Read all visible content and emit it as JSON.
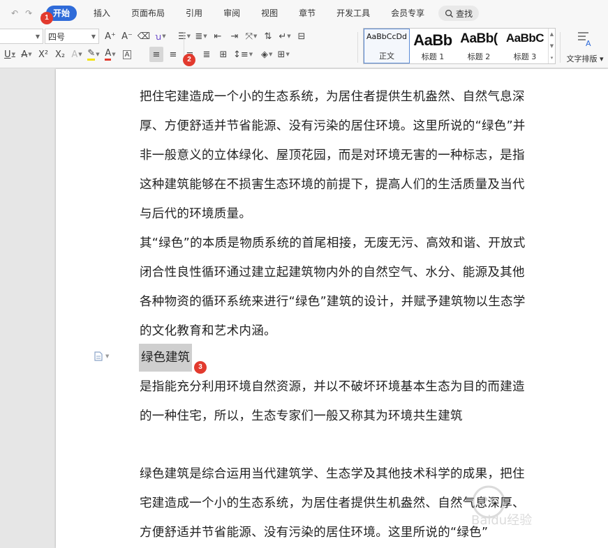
{
  "menu": {
    "tabs": [
      "开始",
      "插入",
      "页面布局",
      "引用",
      "审阅",
      "视图",
      "章节",
      "开发工具",
      "会员专享"
    ],
    "active_index": 0,
    "search_label": "查找"
  },
  "ribbon": {
    "font_size": "四号",
    "font_name": "",
    "styles": [
      {
        "sample": "AaBbCcDd",
        "caption": "正文"
      },
      {
        "sample": "AaBb",
        "caption": "标题 1"
      },
      {
        "sample": "AaBb(",
        "caption": "标题 2"
      },
      {
        "sample": "AaBbC",
        "caption": "标题 3"
      }
    ],
    "text_layout_label": "文字排版"
  },
  "badges": [
    "1",
    "2",
    "3"
  ],
  "document": {
    "para1": "把住宅建造成一个小的生态系统，为居住者提供生机盎然、自然气息深厚、方便舒适并节省能源、没有污染的居住环境。这里所说的“绿色”并非一般意义的立体绿化、屋顶花园，而是对环境无害的一种标志，是指这种建筑能够在不损害生态环境的前提下，提高人们的生活质量及当代与后代的环境质量。",
    "para2": "其“绿色”的本质是物质系统的首尾相接，无废无污、高效和谐、开放式闭合性良性循环通过建立起建筑物内外的自然空气、水分、能源及其他各种物资的循环系统来进行“绿色”建筑的设计，并赋予建筑物以生态学的文化教育和艺术内涵。",
    "heading": "绿色建筑",
    "para3": "是指能充分利用环境自然资源，并以不破坏环境基本生态为目的而建造的一种住宅，所以，生态专家们一般又称其为环境共生建筑",
    "para4": "绿色建筑是综合运用当代建筑学、生态学及其他技术科学的成果，把住宅建造成一个小的生态系统，为居住者提供生机盎然、自然气息深厚、方便舒适并节省能源、没有污染的居住环境。这里所说的“绿色”"
  },
  "watermark_text": "Baidu经验",
  "colors": {
    "accent": "#2f6bd9",
    "badge": "#e23a2e",
    "highlight": "#cfcfcf"
  }
}
